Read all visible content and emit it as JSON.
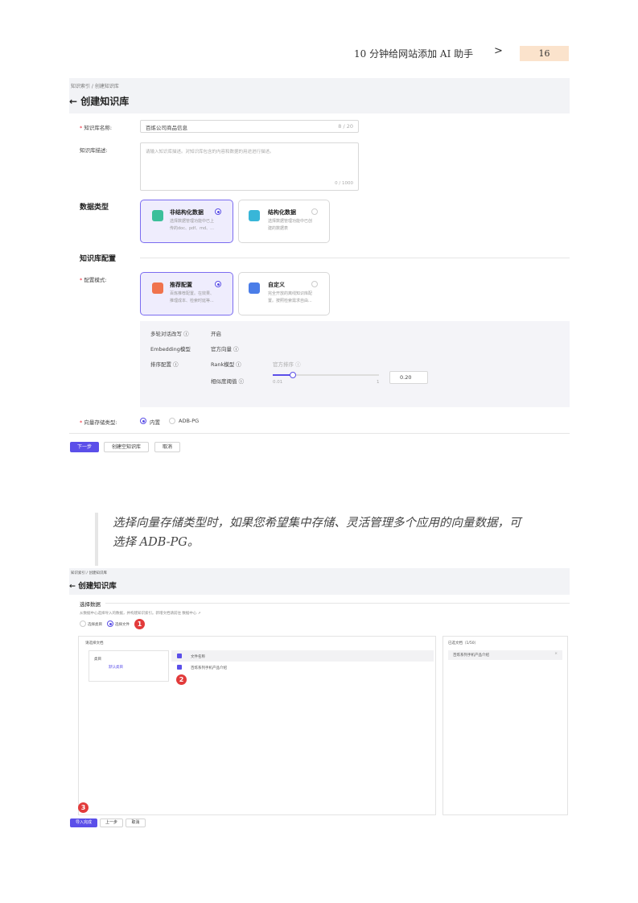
{
  "header": {
    "running_title": "10 分钟给网站添加 AI 助手",
    "arrow": ">",
    "page_number": "16"
  },
  "shot1": {
    "breadcrumb": "知识索引 / 创建知识库",
    "title": "← 创建知识库",
    "name_label": "知识库名称:",
    "name_value": "百炼公司商品信息",
    "name_count": "8 / 20",
    "desc_label": "知识库描述:",
    "desc_placeholder": "请输入知识库描述。对知识库包含的内容和数据的用途进行描述。",
    "desc_count": "0 / 1000",
    "data_type_title": "数据类型",
    "cards_type": [
      {
        "title": "非结构化数据",
        "desc1": "选择数据管理功能中已上",
        "desc2": "传的doc、pdf、md、...",
        "selected": true
      },
      {
        "title": "结构化数据",
        "desc1": "选择数据管理功能中已创",
        "desc2": "建的数据表",
        "selected": false
      }
    ],
    "config_title": "知识库配置",
    "mode_label": "配置模式:",
    "cards_mode": [
      {
        "title": "推荐配置",
        "desc1": "百炼推荐配置。在效果、",
        "desc2": "推理成本、检索时延等...",
        "selected": true
      },
      {
        "title": "自定义",
        "desc1": "完全开放的离线知识库配",
        "desc2": "置。按照检索需求自由...",
        "selected": false
      }
    ],
    "rows": [
      {
        "k": "多轮对话改写 ⓘ",
        "v": "开启"
      },
      {
        "k": "Embedding模型",
        "v": "官方向量 ⓘ"
      },
      {
        "k": "排序配置 ⓘ",
        "v": "Rank模型 ⓘ",
        "v2": "官方排序 ⓘ"
      }
    ],
    "sim_label": "相似度阈值 ⓘ",
    "slider_min": "0.01",
    "slider_max": "1",
    "slider_value": "0.20",
    "storage_label": "向量存储类型:",
    "storage_opt1": "内置",
    "storage_opt2": "ADB-PG",
    "btn_next": "下一步",
    "btn_empty": "创建空知识库",
    "btn_cancel": "取消"
  },
  "quote": {
    "line1": "选择向量存储类型时，如果您希望集中存储、灵活管理多个应用的向量数据，可",
    "line2": "选择 ADB-PG。"
  },
  "shot2": {
    "breadcrumb": "知识索引 / 创建知识库",
    "title": "← 创建知识库",
    "select_data": "选择数据",
    "hint": "从数据中心选择导入的数据，并构建知识索引。新增文档请前往 数据中心 ↗",
    "opt_category": "选择类目",
    "opt_file": "选择文件",
    "please_select": "请选择文档",
    "category": "类目",
    "default_category": "默认类目",
    "col_filename": "文件名称",
    "file1": "百炼系列手机产品介绍",
    "selected_title": "已选文档（1/50）",
    "selected_file": "百炼系列手机产品介绍",
    "remove": "×",
    "btn_import": "导入完成",
    "btn_prev": "上一步",
    "btn_cancel": "取消",
    "markers": [
      "1",
      "2",
      "3"
    ]
  }
}
